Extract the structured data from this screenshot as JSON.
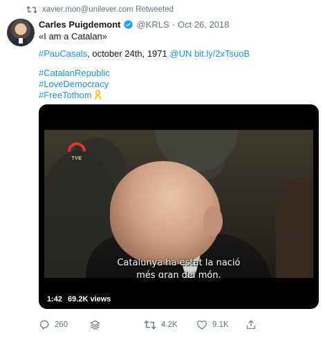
{
  "retweet": {
    "text": "xavier.mon@unilever.com Retweeted",
    "icon": "retweet-icon"
  },
  "author": {
    "name": "Carles Puigdemont",
    "handle": "@KRLS",
    "separator": "·",
    "date": "Oct 26, 2018",
    "verified": true,
    "verified_color": "#1da1f2"
  },
  "tweet": {
    "line1": "«I am a Catalan»",
    "line2_hashtag": "#PauCasals",
    "line2_text": ", october 24th, 1971 ",
    "line2_mention": "@UN",
    "line2_link": "bit.ly/2xTsuoB",
    "hashtags": [
      "#CatalanRepublic",
      "#LoveDemocracy",
      "#FreeTothom"
    ],
    "emoji": "yellow-ribbon-icon"
  },
  "video": {
    "channel_logo": "tve-logo",
    "channel_logo_text": "TVE",
    "subtitle_line1": "Catalunya ha estat la nació",
    "subtitle_line2": "més gran del món.",
    "duration": "1:42",
    "views": "69.2K views"
  },
  "actions": {
    "reply": {
      "icon": "reply-icon",
      "count": "260"
    },
    "stack": {
      "icon": "stack-icon"
    },
    "retweet": {
      "icon": "retweet-icon",
      "count": "4.2K"
    },
    "like": {
      "icon": "heart-icon",
      "count": "9.1K"
    },
    "share": {
      "icon": "share-icon"
    }
  },
  "colors": {
    "link": "#1b95e0",
    "secondary_text": "#657786",
    "primary_text": "#14171a",
    "ribbon": "#f5c518"
  }
}
